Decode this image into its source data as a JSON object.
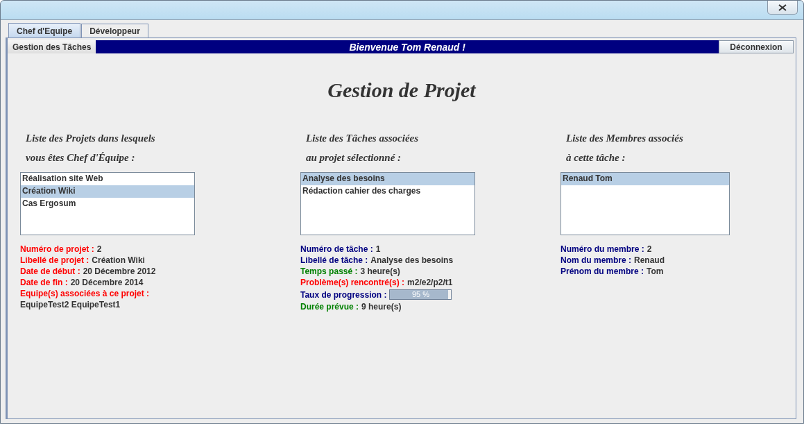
{
  "tabs": [
    {
      "label": "Chef d'Equipe",
      "selected": true
    },
    {
      "label": "Développeur",
      "selected": false
    }
  ],
  "subtabs": [
    {
      "label": "Gestion des Tâches",
      "selected": true
    }
  ],
  "banner": "Bienvenue Tom Renaud !",
  "logout_button": "Déconnexion",
  "heading": "Gestion de Projet",
  "columns": [
    {
      "title": [
        "Liste des Projets dans lesquels",
        "vous êtes Chef d'Équipe :"
      ],
      "items": [
        {
          "label": "Réalisation site Web",
          "selected": false
        },
        {
          "label": "Création Wiki",
          "selected": true
        },
        {
          "label": "Cas Ergosum",
          "selected": false
        }
      ],
      "details": [
        {
          "kind": "text",
          "label": "Numéro de projet :",
          "value": "2",
          "color": "#ff0000"
        },
        {
          "kind": "text",
          "label": "Libellé de projet :",
          "value": "Création Wiki",
          "color": "#ff0000"
        },
        {
          "kind": "text",
          "label": "Date de début :",
          "value": "20 Décembre 2012",
          "color": "#ff0000"
        },
        {
          "kind": "text",
          "label": "Date de fin :",
          "value": "20 Décembre 2014",
          "color": "#ff0000"
        },
        {
          "kind": "text",
          "label": "Equipe(s) associées à ce projet :",
          "color": "#ff0000"
        },
        {
          "kind": "plain",
          "value": "EquipeTest2 EquipeTest1"
        }
      ]
    },
    {
      "title": [
        "Liste des Tâches associées",
        "au projet sélectionné :"
      ],
      "items": [
        {
          "label": "Analyse des besoins",
          "selected": true
        },
        {
          "label": "Rédaction cahier des charges",
          "selected": false
        }
      ],
      "details": [
        {
          "kind": "text",
          "label": "Numéro de tâche :",
          "value": "1",
          "color": "#000080"
        },
        {
          "kind": "text",
          "label": "Libellé de tâche :",
          "value": "Analyse des besoins",
          "color": "#000080"
        },
        {
          "kind": "text",
          "label": "Temps passé :",
          "value": "3 heure(s)",
          "color": "#008000"
        },
        {
          "kind": "text",
          "label": "Problème(s) rencontré(s) :",
          "value": "m2/e2/p2/t1",
          "color": "#ff0000"
        },
        {
          "kind": "progress",
          "label": "Taux de progression :",
          "reading": "95 %",
          "level": 0.95,
          "color": "#000080"
        },
        {
          "kind": "text",
          "label": "Durée prévue :",
          "value": "9 heure(s)",
          "color": "#008000"
        }
      ]
    },
    {
      "title": [
        "Liste des Membres associés",
        "à cette tâche :"
      ],
      "items": [
        {
          "label": "Renaud Tom",
          "selected": true
        }
      ],
      "details": [
        {
          "kind": "text",
          "label": "Numéro du membre :",
          "value": "2",
          "color": "#000080"
        },
        {
          "kind": "text",
          "label": "Nom du membre :",
          "value": "Renaud",
          "color": "#000080"
        },
        {
          "kind": "text",
          "label": "Prénom du membre :",
          "value": "Tom",
          "color": "#000080"
        }
      ]
    }
  ]
}
